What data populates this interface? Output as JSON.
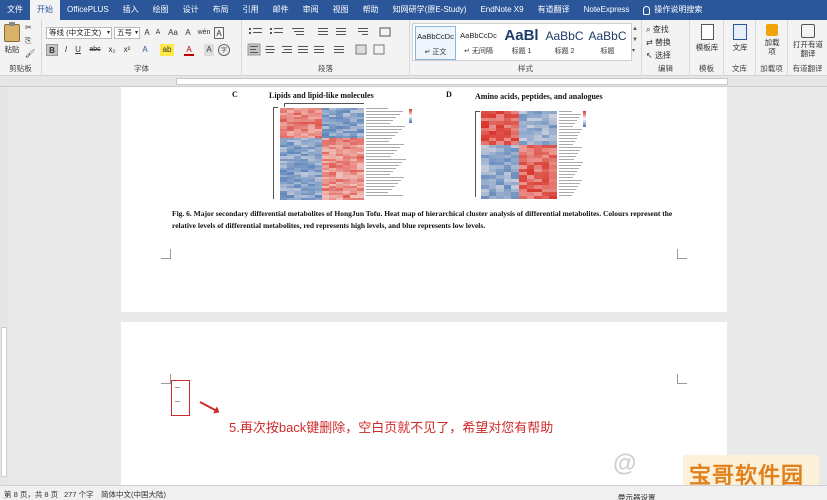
{
  "menu": {
    "items": [
      "文件",
      "开始",
      "OfficePLUS",
      "插入",
      "绘图",
      "设计",
      "布局",
      "引用",
      "邮件",
      "审阅",
      "视图",
      "帮助",
      "知网研学(原E-Study)",
      "EndNote X9",
      "有道翻译",
      "NoteExpress"
    ],
    "active_index": 1,
    "tell_me": "操作说明搜索"
  },
  "ribbon": {
    "clipboard": {
      "paste": "粘贴",
      "label": "剪贴板"
    },
    "font": {
      "font_name": "等线 (中文正文)",
      "font_size": "五号",
      "grow": "A",
      "shrink": "A",
      "aa": "Aa",
      "clear": "A",
      "wen": "wén",
      "a_box": "A",
      "bold": "B",
      "italic": "I",
      "underline": "U",
      "strike": "abc",
      "sub": "x₂",
      "sup": "x²",
      "effects": "A",
      "highlight": "ab",
      "font_color": "A",
      "char_shade": "A",
      "enclose": "字",
      "label": "字体"
    },
    "paragraph": {
      "label": "段落"
    },
    "styles": {
      "items": [
        {
          "preview": "AaBbCcDc",
          "caption": "↵ 正文"
        },
        {
          "preview": "AaBbCcDc",
          "caption": "↵ 无间隔"
        },
        {
          "preview": "AaBl",
          "caption": "标题 1"
        },
        {
          "preview": "AaBbC",
          "caption": "标题 2"
        },
        {
          "preview": "AaBbC",
          "caption": "标题"
        }
      ],
      "label": "样式"
    },
    "editing": {
      "find": "查找",
      "replace": "替换",
      "select": "选择",
      "label": "编辑"
    },
    "template": {
      "button": "模板库",
      "label": "模板"
    },
    "library": {
      "button": "文库",
      "label": "文库"
    },
    "addins": {
      "button": "加载项",
      "label": "加载项"
    },
    "youdao": {
      "button": "打开有道翻译",
      "label": "有道翻译"
    }
  },
  "document": {
    "panel_c": {
      "letter": "C",
      "title": "Lipids and lipid-like molecules"
    },
    "panel_d": {
      "letter": "D",
      "title": "Amino acids, peptides, and analogues"
    },
    "caption": "Fig. 6. Major secondary differential metabolites of HongJun Tofu. Heat map of hierarchical cluster analysis of differential metabolites. Colours represent the relative levels of differential metabolites, red represents high levels, and blue represents low levels.",
    "instruction": "5.再次按back键删除，空白页就不见了，希望对您有帮助"
  },
  "status": {
    "page": "第 8 页，共 8 页",
    "words": "277 个字",
    "language": "简体中文(中国大陆)",
    "display": "显示器设置"
  },
  "watermark": {
    "text": "宝哥软件园"
  },
  "colors": {
    "brand": "#2b579a",
    "instruction_red": "#cf2a2a",
    "heat_red": "#d73027",
    "heat_blue": "#4575b4"
  }
}
